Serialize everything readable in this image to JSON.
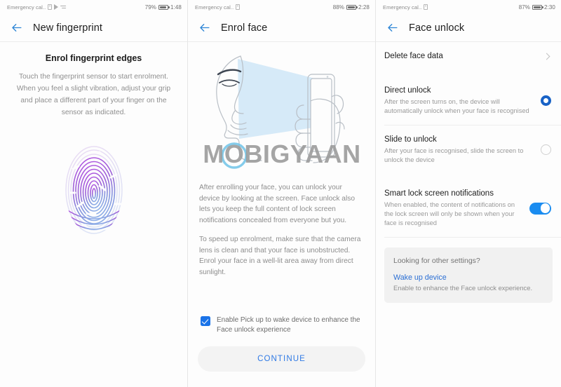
{
  "screens": [
    {
      "statusbar": {
        "carrier": "Emergency cal..",
        "icons": [
          "sim-card-icon",
          "play-icon",
          "send-icon"
        ],
        "battery_percent": "79%",
        "battery_icon": "battery-icon",
        "time": "1:48"
      },
      "appbar": {
        "back_icon": "back-arrow-icon",
        "title": "New fingerprint"
      },
      "content": {
        "title": "Enrol fingerprint edges",
        "description": "Touch the fingerprint sensor to start enrolment. When you feel a slight vibration, adjust your grip and place a different part of your finger on the sensor as indicated.",
        "graphic": "fingerprint-illustration"
      }
    },
    {
      "statusbar": {
        "carrier": "Emergency cal..",
        "icons": [
          "sim-card-icon"
        ],
        "battery_percent": "88%",
        "battery_icon": "battery-icon",
        "time": "2:28"
      },
      "appbar": {
        "back_icon": "back-arrow-icon",
        "title": "Enrol face"
      },
      "content": {
        "graphic": "face-scan-illustration",
        "watermark": "MOBIGYAAN",
        "paragraph1": "After enrolling your face, you can unlock your device by looking at the screen. Face unlock also lets you keep the full content of lock screen notifications concealed from everyone but you.",
        "paragraph2": "To speed up enrolment, make sure that the camera lens is clean and that your face is unobstructed. Enrol your face in a well-lit area away from direct sunlight.",
        "checkbox_label": "Enable Pick up to wake device to enhance the Face unlock experience",
        "checkbox_checked": true,
        "continue_label": "CONTINUE"
      }
    },
    {
      "statusbar": {
        "carrier": "Emergency cal..",
        "icons": [
          "sim-card-icon"
        ],
        "battery_percent": "87%",
        "battery_icon": "battery-icon",
        "time": "2:30"
      },
      "appbar": {
        "back_icon": "back-arrow-icon",
        "title": "Face unlock"
      },
      "rows": [
        {
          "title": "Delete face data",
          "subtitle": "",
          "control": "chevron-right-icon"
        },
        {
          "title": "Direct unlock",
          "subtitle": "After the screen turns on, the device will automatically unlock when your face is recognised",
          "control": "radio-selected"
        },
        {
          "title": "Slide to unlock",
          "subtitle": "After your face is recognised, slide the screen to unlock the device",
          "control": "radio-unselected"
        },
        {
          "title": "Smart lock screen notifications",
          "subtitle": "When enabled, the content of notifications on the lock screen will only be shown when your face is recognised",
          "control": "toggle-on"
        }
      ],
      "infocard": {
        "title": "Looking for other settings?",
        "link": "Wake up device",
        "subtitle": "Enable to enhance the Face unlock experience."
      }
    }
  ],
  "colors": {
    "accent_blue": "#1a73e8",
    "toggle_blue": "#1a8cf0",
    "radio_blue": "#1862c6",
    "link_blue": "#2b6fd4",
    "back_arrow_blue": "#2f86d6",
    "watermark_gray": "#9a9a9a",
    "fingerprint_purple": "#a34fd4",
    "fingerprint_blue": "#7f9fe0",
    "scan_cone_blue": "#cfe6f7"
  }
}
